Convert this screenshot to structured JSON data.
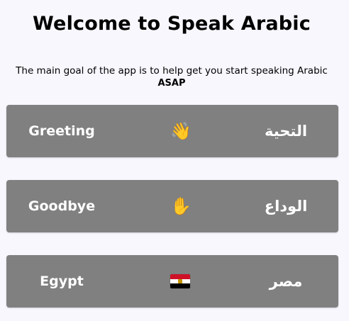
{
  "header": {
    "title": "Welcome to Speak Arabic",
    "intro": "The main goal of the app is to help get you start speaking Arabic",
    "intro_strong": "ASAP"
  },
  "cards": [
    {
      "english": "Greeting",
      "emoji": "👋",
      "arabic": "التحية",
      "icon": "waving-hand-icon"
    },
    {
      "english": "Goodbye",
      "emoji": "✋",
      "arabic": "الوداع",
      "icon": "raised-hand-icon"
    },
    {
      "english": "Egypt",
      "emoji": "",
      "arabic": "مصر",
      "icon": "egypt-flag-icon"
    }
  ],
  "colors": {
    "background": "#f8f7fe",
    "card": "#808080",
    "card_text": "#ffffff",
    "flag_red": "#ce1126",
    "flag_black": "#000000",
    "flag_eagle": "#c09300"
  }
}
